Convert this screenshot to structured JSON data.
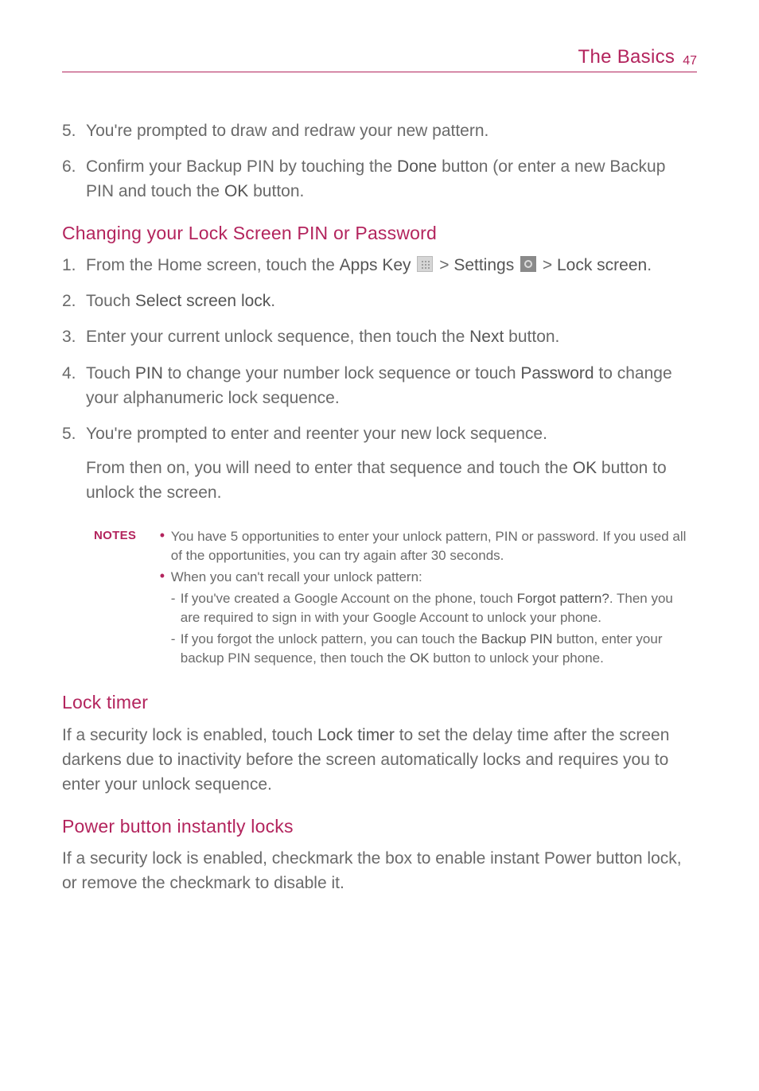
{
  "header": {
    "title": "The Basics",
    "page": "47"
  },
  "pattern_steps": {
    "step5_num": "5.",
    "step5_text": "You're prompted to draw and redraw your new pattern.",
    "step6_num": "6.",
    "step6_pre": "Confirm your Backup PIN by touching the ",
    "step6_done": "Done",
    "step6_mid": " button (or enter a new Backup PIN and touch the ",
    "step6_ok": "OK",
    "step6_post": " button."
  },
  "changing": {
    "heading": "Changing your Lock Screen PIN or Password",
    "s1_num": "1.",
    "s1_pre": "From the Home screen, touch the ",
    "s1_apps": "Apps Key",
    "s1_gt1": " > ",
    "s1_settings": "Settings",
    "s1_gt2": " > ",
    "s1_lock": "Lock screen",
    "s1_period": ".",
    "s2_num": "2.",
    "s2_pre": "Touch ",
    "s2_bold": "Select screen lock",
    "s2_post": ".",
    "s3_num": "3.",
    "s3_pre": "Enter your current unlock sequence, then touch the ",
    "s3_bold": "Next",
    "s3_post": " button.",
    "s4_num": "4.",
    "s4_pre": "Touch ",
    "s4_pin": "PIN",
    "s4_mid": " to change your number lock sequence or touch ",
    "s4_pw": "Password",
    "s4_post": " to change your alphanumeric lock sequence.",
    "s5_num": "5.",
    "s5_text": "You're prompted to enter and reenter your new lock sequence.",
    "s5_para_pre": "From then on, you will need to enter that sequence and touch the ",
    "s5_para_ok": "OK",
    "s5_para_post": " button to unlock the screen."
  },
  "notes": {
    "label": "NOTES",
    "b1": "You have 5 opportunities to enter your unlock pattern, PIN or password. If you used all of the opportunities, you can try again after 30 seconds.",
    "b2": "When you can't recall your unlock pattern:",
    "d1_pre": "If you've created a Google Account on the phone, touch ",
    "d1_bold": "Forgot pattern?",
    "d1_post": ". Then you are required to sign in with your Google Account to unlock your phone.",
    "d2_pre": "If you forgot the unlock pattern, you can touch the ",
    "d2_bold1": "Backup PIN",
    "d2_mid": " button, enter your backup PIN sequence, then touch the ",
    "d2_bold2": "OK",
    "d2_post": " button to unlock your phone."
  },
  "lock_timer": {
    "heading": "Lock timer",
    "pre": "If a security lock is enabled, touch ",
    "bold": "Lock timer",
    "post": " to set the delay time after the screen darkens due to inactivity before the screen automatically locks and requires you to enter your unlock sequence."
  },
  "power_button": {
    "heading": "Power button instantly locks",
    "text": "If a security lock is enabled, checkmark the box to enable instant Power button lock, or remove the checkmark to disable it."
  }
}
